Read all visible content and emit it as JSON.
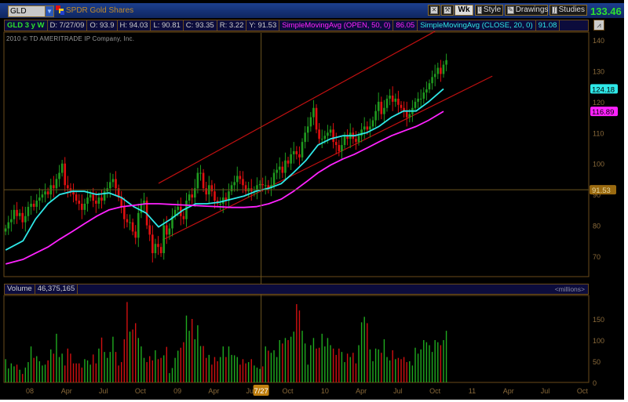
{
  "header": {
    "symbol": "GLD",
    "name": "SPDR Gold Shares",
    "buttons": {
      "wk": "Wk",
      "style": "Style",
      "drawings": "Drawings",
      "studies": "Studies"
    },
    "last_price": "133.46",
    "last_price_color": "#2ee02e"
  },
  "info_bar": {
    "title": "GLD 3 y W",
    "date": "D: 7/27/09",
    "open": "O: 93.9",
    "high": "H: 94.03",
    "low": "L: 90.81",
    "close": "C: 93.35",
    "range": "R: 3.22",
    "y": "Y: 91.53",
    "sma50_label": "SimpleMovingAvg (OPEN, 50, 0)",
    "sma50_value": "86.05",
    "sma20_label": "SimpleMovingAvg (CLOSE, 20, 0)",
    "sma20_value": "91.08"
  },
  "copyright": "2010 © TD AMERITRADE IP Company, Inc.",
  "volume_bar": {
    "label": "Volume",
    "value": "46,375,165",
    "unit": "<millions>"
  },
  "chart_data": [
    {
      "type": "candlestick",
      "interval": "weekly",
      "start_date": "2007-11-02",
      "close": [
        79,
        81,
        82,
        85,
        83,
        84,
        81,
        83,
        86,
        87,
        86,
        88,
        89,
        90,
        91,
        90,
        93,
        92,
        95,
        97,
        100,
        93,
        92,
        91,
        90,
        88,
        87,
        85,
        87,
        89,
        90,
        88,
        87,
        89,
        88,
        91,
        92,
        94,
        95,
        92,
        89,
        86,
        82,
        81,
        81,
        78,
        76,
        84,
        87,
        88,
        80,
        77,
        71,
        74,
        73,
        71,
        80,
        77,
        79,
        83,
        85,
        86,
        83,
        82,
        88,
        90,
        89,
        92,
        97,
        97,
        92,
        90,
        93,
        91,
        88,
        87,
        87,
        89,
        88,
        91,
        93,
        94,
        96,
        95,
        93,
        91,
        92,
        91,
        91,
        93,
        93.35,
        93,
        93,
        92,
        93,
        97,
        98,
        99,
        97,
        101,
        100,
        103,
        104,
        103,
        102,
        107,
        110,
        112,
        115,
        118,
        111,
        108,
        108,
        109,
        110,
        111,
        107,
        106,
        104,
        106,
        109,
        108,
        110,
        108,
        107,
        109,
        111,
        112,
        111,
        112,
        114,
        117,
        120,
        116,
        118,
        121,
        122,
        120,
        121,
        119,
        118,
        117,
        115,
        116,
        118,
        120,
        121,
        121,
        123,
        124,
        126,
        128,
        129,
        131,
        129,
        132,
        133.46
      ],
      "ylim": [
        65,
        142
      ],
      "y_ticks": [
        70,
        80,
        90,
        100,
        110,
        120,
        130,
        140
      ],
      "studies": [
        {
          "name": "SimpleMovingAvg (CLOSE, 20, 0)",
          "color": "#2ee8e8",
          "last": "124.18",
          "monthly_start": "2007-11",
          "values": [
            72,
            75,
            82,
            87,
            90,
            91,
            91,
            90,
            90.5,
            89,
            86,
            84,
            79.5,
            82,
            85,
            87,
            87,
            87.5,
            88.5,
            89.5,
            91.08,
            92,
            93.5,
            97,
            101,
            106,
            108,
            109,
            109,
            110,
            112,
            115,
            117,
            117,
            120,
            124.18
          ]
        },
        {
          "name": "SimpleMovingAvg (OPEN, 50, 0)",
          "color": "#ff22ff",
          "last": "116.89",
          "monthly_start": "2007-11",
          "values": [
            67.5,
            69,
            71,
            73,
            75.5,
            78,
            80.5,
            83,
            85,
            86,
            86.5,
            87,
            87,
            86.8,
            86.6,
            86.4,
            86.2,
            86,
            85.8,
            85.8,
            86.05,
            87,
            88.5,
            91,
            94,
            97,
            99.5,
            101.5,
            103,
            105,
            107,
            109,
            110.5,
            112,
            114,
            116.89
          ]
        }
      ],
      "trendlines": [
        {
          "from": [
            "2008-11-15",
            93.6
          ],
          "to": [
            "2010-10-01",
            142.8
          ],
          "color": "#c01010"
        },
        {
          "from": [
            "2008-11-25",
            75.3
          ],
          "to": [
            "2011-02-20",
            128.3
          ],
          "color": "#c01010"
        }
      ],
      "crosshair": {
        "date": "7/27",
        "date_iso": "2009-07-27",
        "price": "91.53"
      },
      "up_color": "#1f9a1f",
      "down_color": "#e01010"
    },
    {
      "type": "bar",
      "title": "Volume",
      "unit": "millions",
      "values": [
        55,
        33,
        45,
        38,
        42,
        30,
        20,
        35,
        48,
        85,
        58,
        62,
        50,
        40,
        42,
        52,
        78,
        68,
        115,
        60,
        68,
        40,
        80,
        68,
        45,
        45,
        45,
        35,
        55,
        52,
        42,
        66,
        45,
        80,
        106,
        72,
        58,
        72,
        108,
        72,
        40,
        48,
        102,
        190,
        120,
        125,
        140,
        105,
        85,
        58,
        48,
        62,
        52,
        76,
        55,
        58,
        64,
        84,
        22,
        34,
        58,
        75,
        82,
        95,
        158,
        122,
        150,
        102,
        135,
        86,
        86,
        58,
        65,
        42,
        60,
        50,
        60,
        85,
        60,
        85,
        65,
        64,
        60,
        42,
        55,
        45,
        48,
        55,
        40,
        35,
        32,
        38,
        85,
        75,
        70,
        76,
        60,
        100,
        92,
        105,
        100,
        108,
        120,
        185,
        170,
        122,
        92,
        42,
        88,
        105,
        80,
        82,
        115,
        85,
        105,
        88,
        80,
        65,
        80,
        72,
        48,
        68,
        60,
        70,
        45,
        88,
        142,
        155,
        140,
        78,
        50,
        80,
        78,
        70,
        102,
        60,
        52,
        76,
        55,
        58,
        55,
        60,
        48,
        50,
        40,
        82,
        68,
        78,
        100,
        95,
        88,
        72,
        100,
        95,
        88,
        100,
        122
      ],
      "ylim": [
        0,
        195
      ],
      "y_ticks": [
        0,
        50,
        100,
        150
      ]
    }
  ],
  "x_ticks": [
    {
      "label": "08",
      "date": "2008-01-01"
    },
    {
      "label": "Apr",
      "date": "2008-04-01"
    },
    {
      "label": "Jul",
      "date": "2008-07-01"
    },
    {
      "label": "Oct",
      "date": "2008-10-01"
    },
    {
      "label": "09",
      "date": "2009-01-01"
    },
    {
      "label": "Apr",
      "date": "2009-04-01"
    },
    {
      "label": "Jul",
      "date": "2009-07-01"
    },
    {
      "label": "Oct",
      "date": "2009-10-01"
    },
    {
      "label": "10",
      "date": "2010-01-01"
    },
    {
      "label": "Apr",
      "date": "2010-04-01"
    },
    {
      "label": "Jul",
      "date": "2010-07-01"
    },
    {
      "label": "Oct",
      "date": "2010-10-01"
    },
    {
      "label": "11",
      "date": "2011-01-01"
    },
    {
      "label": "Apr",
      "date": "2011-04-01"
    },
    {
      "label": "Jul",
      "date": "2011-07-01"
    },
    {
      "label": "Oct",
      "date": "2011-10-01"
    }
  ]
}
